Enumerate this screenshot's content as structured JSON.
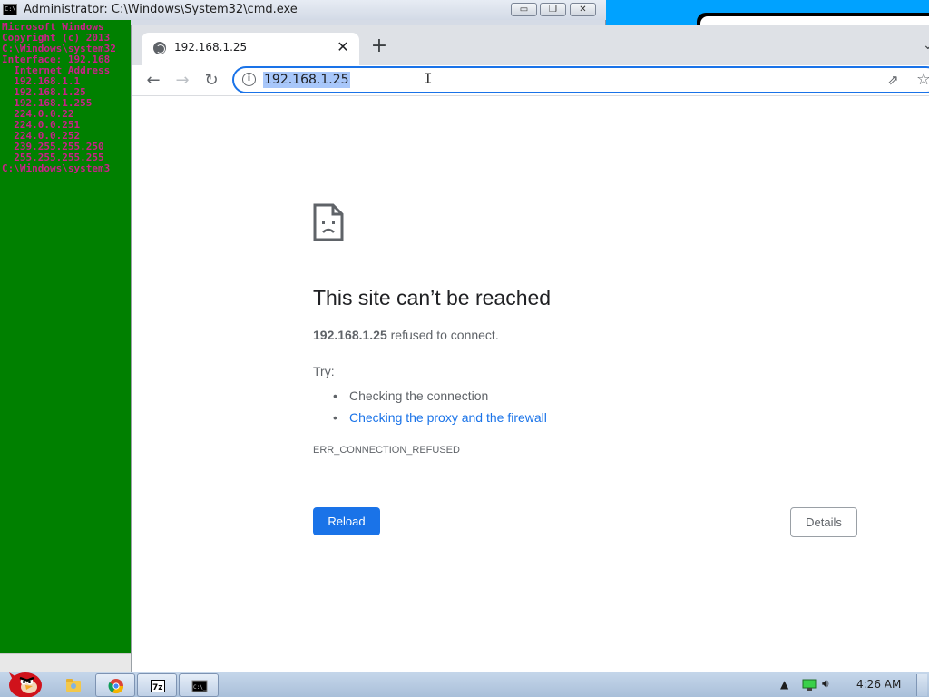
{
  "cmd": {
    "title": "Administrator: C:\\Windows\\System32\\cmd.exe",
    "lines": [
      "Microsoft Windows",
      "Copyright (c) 2013",
      "",
      "C:\\Windows\\system32",
      "",
      "Interface: 192.168",
      "  Internet Address",
      "  192.168.1.1",
      "  192.168.1.25",
      "  192.168.1.255",
      "  224.0.0.22",
      "  224.0.0.251",
      "  224.0.0.252",
      "  239.255.255.250",
      "  255.255.255.255",
      "",
      "C:\\Windows\\system3"
    ],
    "buttons": {
      "minimize": "▭",
      "restore": "❐",
      "close": "✕"
    }
  },
  "browser": {
    "tab": {
      "title": "192.168.1.25",
      "close": "✕"
    },
    "new_tab": "+",
    "nav": {
      "back": "←",
      "forward": "→",
      "reload": "↻"
    },
    "omnibox": {
      "url": "192.168.1.25",
      "info": "i"
    }
  },
  "error_page": {
    "title": "This site can’t be reached",
    "host": "192.168.1.25",
    "host_suffix": " refused to connect.",
    "try_label": "Try:",
    "suggestions": [
      "Checking the connection",
      "Checking the proxy and the firewall"
    ],
    "error_code": "ERR_CONNECTION_REFUSED",
    "reload_label": "Reload",
    "details_label": "Details"
  },
  "taskbar": {
    "clock": "4:26 AM",
    "icons": [
      "angry-bird-start-icon",
      "explorer-icon",
      "chrome-icon",
      "7zip-icon",
      "cmd-icon"
    ]
  },
  "colors": {
    "cmd_background": "#008000",
    "cmd_text": "#cc1f8a",
    "accent": "#1a73e8",
    "link": "#1a73e8"
  }
}
